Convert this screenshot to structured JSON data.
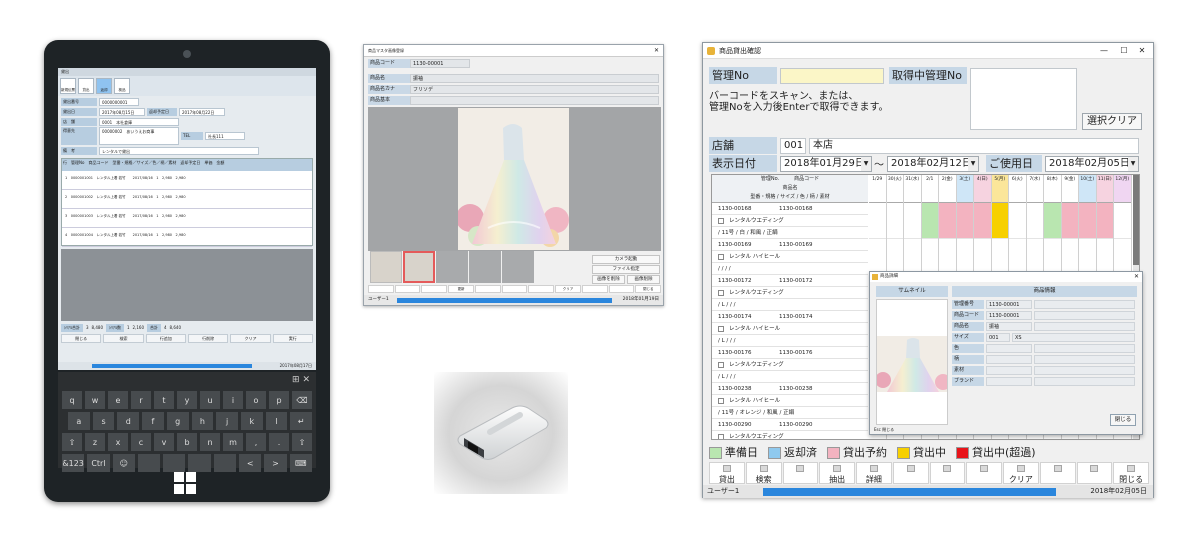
{
  "tablet": {
    "toolbar": [
      "新規伝票",
      "貸出",
      "返却",
      "検品"
    ],
    "fields": [
      {
        "label": "貸出番号",
        "value": "0000000001"
      },
      {
        "label": "貸出日",
        "value": "2017年08月15日",
        "extra_label": "返却予定日",
        "extra_value": "2017年08月22日"
      },
      {
        "label": "店　舗",
        "value": "0001　本社倉庫"
      },
      {
        "label": "得意先",
        "value": "00000002　あいうえお商事",
        "extra_label": "TEL",
        "extra_value": "社長111"
      },
      {
        "label": "備　考",
        "value": "レンタルで貸出"
      }
    ],
    "grid_header": "行　管理No　商品コード　型番・規格／サイズ／色／柄／素材　返却予定日　単価　金額",
    "grid_rows": [
      "1　0000001001　レンタル上着 若竹　　2017/08/16　1　2,980　2,980",
      "2　0000001002　レンタル上着 若竹　　2017/08/16　1　2,980　2,980",
      "3　0000001003　レンタル上着 若竹　　2017/08/16　1　2,980　2,980",
      "4　0000001004　レンタル上着 若竹　　2017/08/16　1　2,980　2,980"
    ],
    "summary": [
      {
        "label": "ｼﾘｱﾙ合計",
        "value": "3"
      },
      {
        "value": "8,480"
      },
      {
        "label": "ｼﾘｱﾙ数",
        "value": "1"
      },
      {
        "value": "2,160"
      },
      {
        "label": "合計",
        "value": "4"
      },
      {
        "value": "8,640"
      }
    ],
    "buttons": [
      "閉じる",
      "検索",
      "行追加",
      "行削除",
      "クリア",
      "実行"
    ],
    "status_date": "2017年08月17日",
    "keyboard": [
      [
        "q",
        "w",
        "e",
        "r",
        "t",
        "y",
        "u",
        "i",
        "o",
        "p",
        "⌫"
      ],
      [
        "a",
        "s",
        "d",
        "f",
        "g",
        "h",
        "j",
        "k",
        "l",
        "↵"
      ],
      [
        "⇧",
        "z",
        "x",
        "c",
        "v",
        "b",
        "n",
        "m",
        ",",
        ".",
        "⇧"
      ],
      [
        "&123",
        "Ctrl",
        "☺",
        "",
        "",
        "",
        "",
        "<",
        ">",
        "⌨"
      ]
    ],
    "kbd_icons": [
      "⊞",
      "✕"
    ]
  },
  "product_window": {
    "title": "商品マスタ画像登録",
    "rows": [
      {
        "label": "商品コード",
        "value": "1130-00001"
      },
      {
        "label": "商品名",
        "value": "振袖"
      },
      {
        "label": "商品名カナ",
        "value": "フリソデ"
      },
      {
        "label": "商品基本",
        "value": ""
      }
    ],
    "buttons": [
      "カメラ起動",
      "ファイル指定",
      "画像を削除",
      "画像削除"
    ],
    "footer": [
      "",
      "",
      "",
      "更新",
      "",
      "",
      "",
      "クリア",
      "",
      "",
      "閉じる"
    ],
    "status_user": "ユーザー1",
    "status_date": "2018年01月19日"
  },
  "rental_window": {
    "title": "商品貸出確認",
    "kanri_label": "管理No",
    "kanri_value": "",
    "getting_label": "取得中管理No",
    "instruction1": "バーコードをスキャン、または、",
    "instruction2": "管理Noを入力後Enterで取得できます。",
    "clear_button": "選択クリア",
    "store_label": "店舗",
    "store_code": "001",
    "store_name": "本店",
    "date_label": "表示日付",
    "date_from": "2018年01月29日",
    "tilde": "～",
    "date_to": "2018年02月12日",
    "use_label": "ご使用日",
    "use_date": "2018年02月05日",
    "grid_head": [
      "管理No.",
      "商品コード",
      "商品名",
      "型番・規格 / サイズ / 色 / 柄 / 素材"
    ],
    "grid_rows": [
      "1130-00168　　　　　1130-00168",
      "レンタルウエディング",
      "/ 11号 / 白 / 和風 / 正絹",
      "1130-00169　　　　　1130-00169",
      "レンタル ハイヒール",
      "/ / / /",
      "1130-00172　　　　　1130-00172",
      "レンタルウエディング",
      "/ L / / /",
      "1130-00174　　　　　1130-00174",
      "レンタル ハイヒール",
      "/ L / / /",
      "1130-00176　　　　　1130-00176",
      "レンタルウエディング",
      "/ L / / /",
      "1130-00238　　　　　1130-00238",
      "レンタル ハイヒール",
      "/ 11号 / オレンジ / 和風 / 正絹",
      "1130-00290　　　　　1130-00290",
      "レンタルウエディング",
      "/ 2L / オレンジ / 無地 / その他",
      "1130-00298　　　　　1130-00298",
      "レンタル ハイヒール"
    ],
    "days": [
      "1/29",
      "30(火)",
      "31(水)",
      "2/1",
      "2(金)",
      "3(土)",
      "4(日)",
      "5(月)",
      "6(火)",
      "7(水)",
      "8(木)",
      "9(金)",
      "10(土)",
      "11(日)",
      "12(月)"
    ],
    "popup": {
      "title": "商品詳細",
      "thumb_head": "サムネイル",
      "info_head": "商品情報",
      "rows": [
        {
          "label": "管理番号",
          "value": "1130-00001",
          "extra": ""
        },
        {
          "label": "商品コード",
          "value": "1130-00001",
          "extra": ""
        },
        {
          "label": "商品名",
          "value": "振袖",
          "extra": ""
        },
        {
          "label": "サイズ",
          "value": "001",
          "extra": "XS"
        },
        {
          "label": "色",
          "value": "",
          "extra": ""
        },
        {
          "label": "柄",
          "value": "",
          "extra": ""
        },
        {
          "label": "素材",
          "value": "",
          "extra": ""
        },
        {
          "label": "ブランド",
          "value": "",
          "extra": ""
        }
      ],
      "close": "閉じる",
      "footer": "Esc 閉じる"
    },
    "legend": [
      {
        "label": "準備日",
        "color": "#b9e6b0"
      },
      {
        "label": "返却済",
        "color": "#8fc9ee"
      },
      {
        "label": "貸出予約",
        "color": "#f3b3c0"
      },
      {
        "label": "貸出中",
        "color": "#f7d000"
      },
      {
        "label": "貸出中(超過)",
        "color": "#e8141a"
      }
    ],
    "footer": [
      "貸出",
      "検索",
      "",
      "抽出",
      "詳細",
      "",
      "",
      "",
      "クリア",
      "",
      "",
      "閉じる"
    ],
    "status_user": "ユーザー1",
    "status_date": "2018年02月05日"
  }
}
